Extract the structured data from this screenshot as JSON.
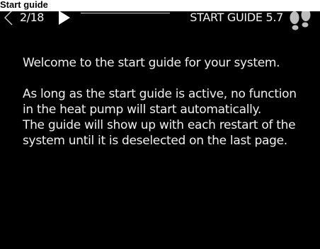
{
  "caption": "Start guide",
  "header": {
    "prev_icon": "chevron-left-outline-icon",
    "page_counter": "2/18",
    "next_icon": "triangle-right-filled-icon",
    "title": "START GUIDE 5.7",
    "guide_icon": "footprints-icon"
  },
  "content": {
    "paragraph_1": "Welcome to the start guide for your system.",
    "paragraph_2": "As long as the start guide is active, no function in the heat pump will start automatically.",
    "paragraph_3": "The guide will show up with each restart of the system until it is deselected on the last page."
  },
  "colors": {
    "background": "#000000",
    "text": "#f0f0f0",
    "caption_bg": "#ffffff",
    "caption_text": "#000000"
  }
}
